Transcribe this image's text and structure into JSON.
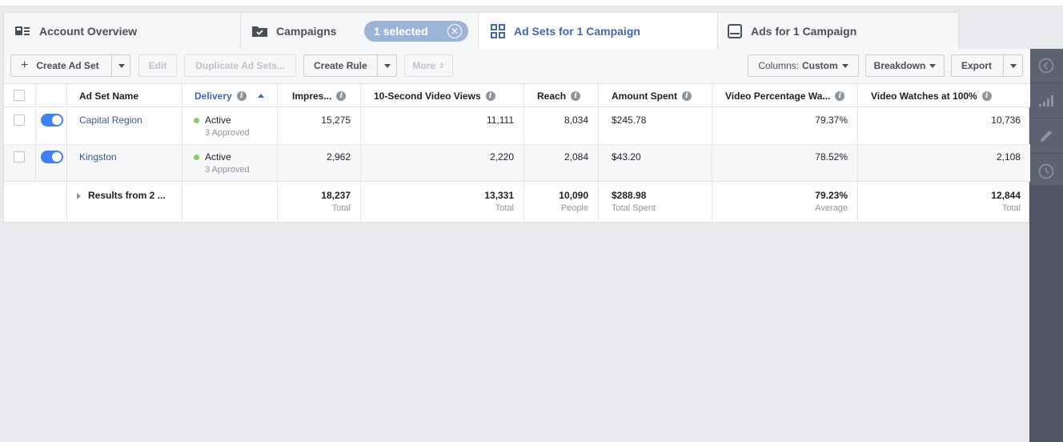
{
  "tabs": {
    "account_overview": "Account Overview",
    "campaigns": "Campaigns",
    "selected_pill": "1 selected",
    "ad_sets": "Ad Sets for 1 Campaign",
    "ads": "Ads for 1 Campaign"
  },
  "toolbar": {
    "create_ad_set": "Create Ad Set",
    "edit": "Edit",
    "duplicate": "Duplicate Ad Sets...",
    "create_rule": "Create Rule",
    "more": "More",
    "columns_prefix": "Columns:",
    "columns_value": "Custom",
    "breakdown": "Breakdown",
    "export": "Export"
  },
  "columns": {
    "ad_set_name": "Ad Set Name",
    "delivery": "Delivery",
    "impressions": "Impres...",
    "video_views": "10-Second Video Views",
    "reach": "Reach",
    "amount_spent": "Amount Spent",
    "video_percentage": "Video Percentage Wa...",
    "video_watches": "Video Watches at 100%"
  },
  "rows": [
    {
      "name": "Capital Region",
      "delivery": "Active",
      "delivery_sub": "3 Approved",
      "impressions": "15,275",
      "video_views": "11,111",
      "reach": "8,034",
      "amount_spent": "$245.78",
      "video_percentage": "79.37%",
      "video_watches": "10,736"
    },
    {
      "name": "Kingston",
      "delivery": "Active",
      "delivery_sub": "3 Approved",
      "impressions": "2,962",
      "video_views": "2,220",
      "reach": "2,084",
      "amount_spent": "$43.20",
      "video_percentage": "78.52%",
      "video_watches": "2,108"
    }
  ],
  "totals": {
    "label": "Results from 2 ...",
    "impressions": "18,237",
    "impressions_lbl": "Total",
    "video_views": "13,331",
    "video_views_lbl": "Total",
    "reach": "10,090",
    "reach_lbl": "People",
    "amount_spent": "$288.98",
    "amount_spent_lbl": "Total Spent",
    "video_percentage": "79.23%",
    "video_percentage_lbl": "Average",
    "video_watches": "12,844",
    "video_watches_lbl": "Total"
  },
  "colors": {
    "accent": "#4267b2",
    "toggle_on": "#4080ff",
    "status_active": "#8cc86a",
    "rail": "#4e5665"
  }
}
